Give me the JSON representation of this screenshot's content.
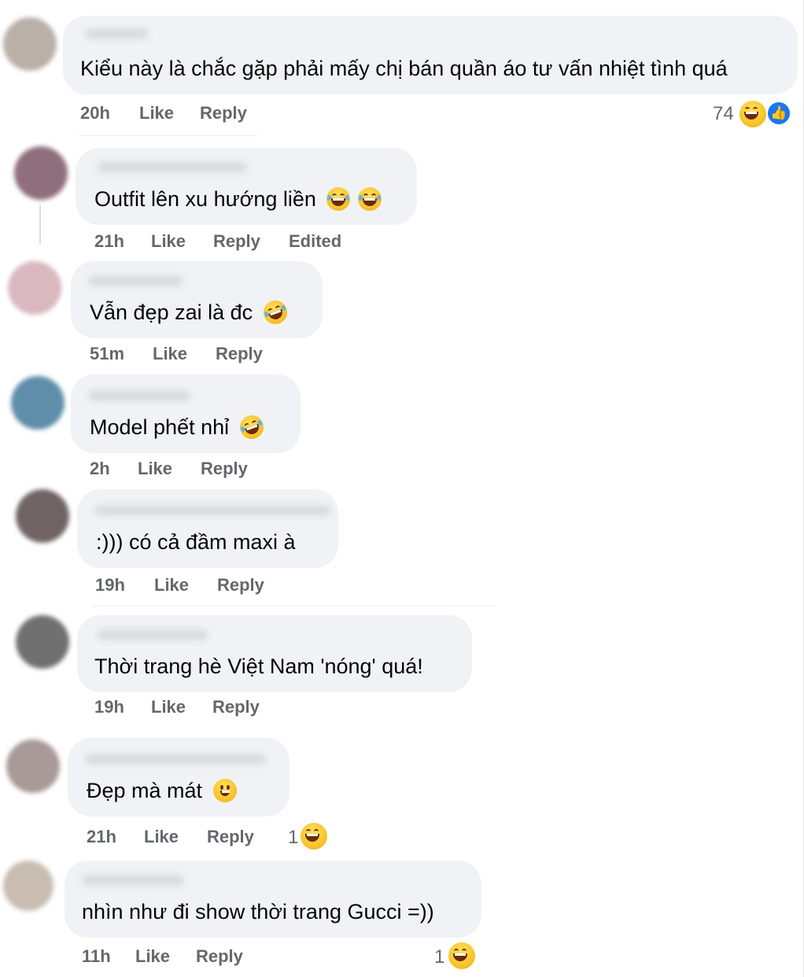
{
  "comments": [
    {
      "text": "Kiểu này là chắc gặp phải mấy chị bán quần áo tư vấn nhiệt tình quá",
      "time": "20h",
      "like": "Like",
      "reply": "Reply",
      "reactions": "74",
      "emojis": []
    },
    {
      "text": "Outfit lên xu hướng liền",
      "time": "21h",
      "like": "Like",
      "reply": "Reply",
      "edited": "Edited",
      "emojis": [
        "grin-sweat",
        "grin-sweat"
      ]
    },
    {
      "text": "Vẫn đẹp zai là đc",
      "time": "51m",
      "like": "Like",
      "reply": "Reply",
      "emojis": [
        "rofl"
      ]
    },
    {
      "text": "Model phết nhỉ",
      "time": "2h",
      "like": "Like",
      "reply": "Reply",
      "emojis": [
        "rofl"
      ]
    },
    {
      "text": ":))) có cả đầm maxi à",
      "time": "19h",
      "like": "Like",
      "reply": "Reply",
      "emojis": []
    },
    {
      "text": "Thời trang hè Việt Nam 'nóng' quá!",
      "time": "19h",
      "like": "Like",
      "reply": "Reply",
      "emojis": []
    },
    {
      "text": "Đẹp mà mát",
      "time": "21h",
      "like": "Like",
      "reply": "Reply",
      "reactions": "1",
      "emojis": [
        "grinning"
      ]
    },
    {
      "text": "nhìn như đi show thời trang Gucci =))",
      "time": "11h",
      "like": "Like",
      "reply": "Reply",
      "reactions": "1",
      "emojis": []
    }
  ],
  "colors": {
    "bubble": "#f0f2f5",
    "meta": "#65676b",
    "text": "#050505",
    "like_blue": "#1877f2"
  },
  "icons": {
    "haha": "laughing-face-icon",
    "like": "thumbs-up-icon",
    "rofl": "rolling-laughing-icon",
    "smile": "grinning-face-icon"
  }
}
